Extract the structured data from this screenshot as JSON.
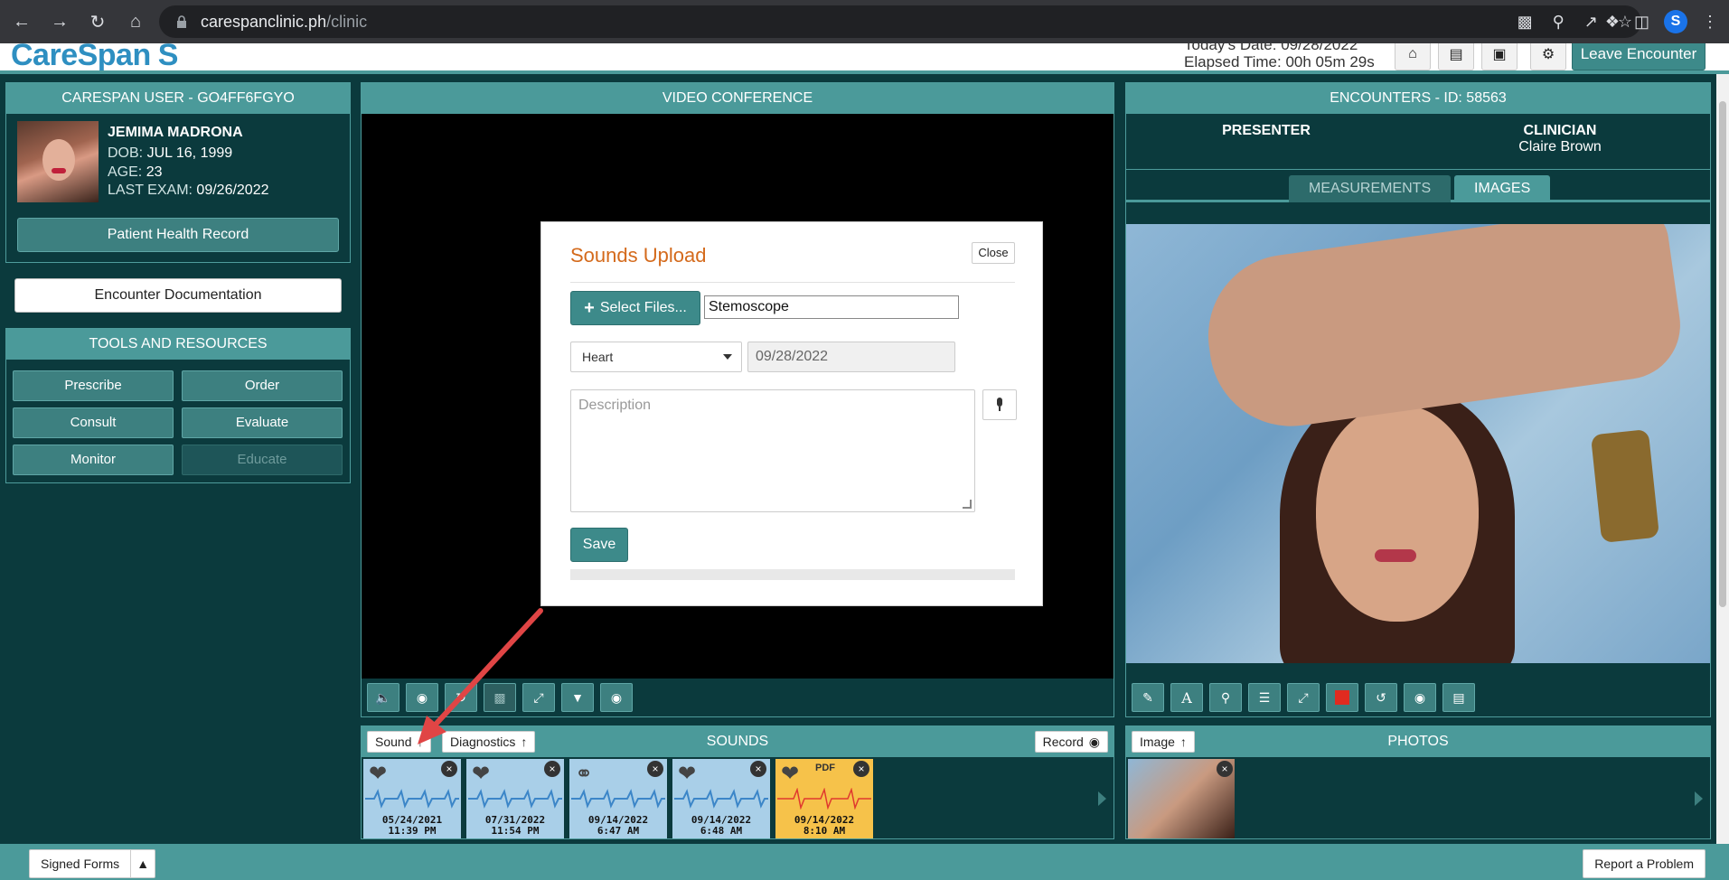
{
  "browser": {
    "url_host": "carespanclinic.ph",
    "url_path": "/clinic"
  },
  "header": {
    "logo": "CareSpan",
    "todays_date": "Today's Date: 09/28/2022",
    "elapsed_time": "Elapsed Time: 00h 05m 29s",
    "leave_label": "Leave Encounter"
  },
  "user_panel": {
    "title": "CARESPAN USER - GO4FF6FGYO",
    "name": "JEMIMA MADRONA",
    "dob_key": "DOB:",
    "dob": "JUL 16, 1999",
    "age_key": "AGE:",
    "age": "23",
    "last_exam_key": "LAST EXAM:",
    "last_exam": "09/26/2022",
    "phr_button": "Patient Health Record"
  },
  "encounter_doc_button": "Encounter Documentation",
  "tools": {
    "title": "TOOLS AND RESOURCES",
    "buttons": [
      "Prescribe",
      "Order",
      "Consult",
      "Evaluate",
      "Monitor",
      "Educate"
    ]
  },
  "video": {
    "title": "VIDEO CONFERENCE"
  },
  "modal": {
    "title": "Sounds Upload",
    "close_label": "Close",
    "select_files_label": "Select Files...",
    "file_name": "Stemoscope",
    "organ_selected": "Heart",
    "date": "09/28/2022",
    "description_placeholder": "Description",
    "save_label": "Save"
  },
  "sounds": {
    "title": "SOUNDS",
    "sound_btn": "Sound",
    "diagnostics_btn": "Diagnostics",
    "record_btn": "Record",
    "items": [
      {
        "date": "05/24/2021",
        "time": "11:39 PM",
        "icon": "heart-icon"
      },
      {
        "date": "07/31/2022",
        "time": "11:54 PM",
        "icon": "heart-icon"
      },
      {
        "date": "09/14/2022",
        "time": "6:47 AM",
        "icon": "ear-icon"
      },
      {
        "date": "09/14/2022",
        "time": "6:48 AM",
        "icon": "heart-icon"
      },
      {
        "date": "09/14/2022",
        "time": "8:10 AM",
        "icon": "pdf-heart-icon",
        "pdf_label": "PDF"
      }
    ]
  },
  "encounters": {
    "title": "ENCOUNTERS - ID: 58563",
    "presenter_label": "PRESENTER",
    "clinician_label": "CLINICIAN",
    "clinician_name": "Claire Brown",
    "tab_measurements": "MEASUREMENTS",
    "tab_images": "IMAGES"
  },
  "photos": {
    "title": "PHOTOS",
    "image_btn": "Image"
  },
  "footer": {
    "signed_forms": "Signed Forms",
    "report_problem": "Report a Problem"
  },
  "colors": {
    "teal": "#4b9a9a",
    "dark_bg": "#0b3a3d",
    "modal_title": "#d46a1c",
    "arrow": "#e04545"
  }
}
